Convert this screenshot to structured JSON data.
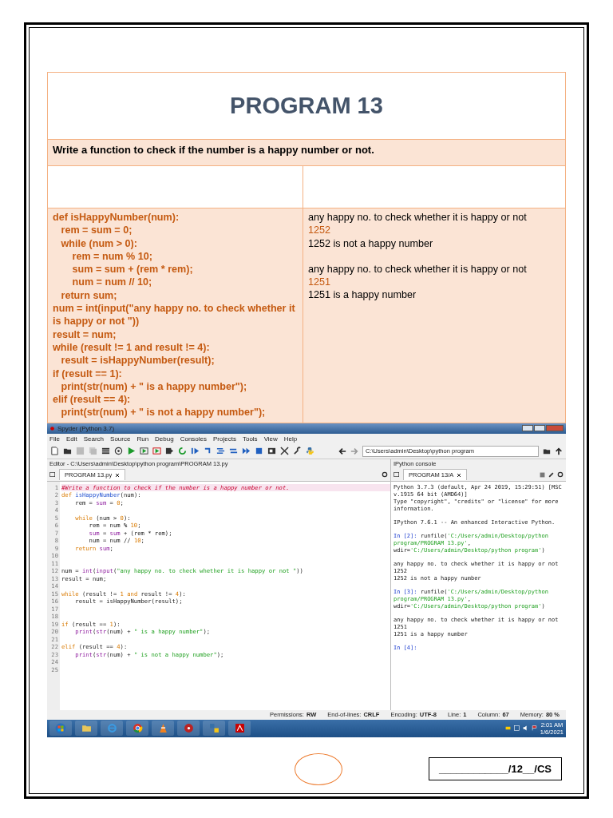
{
  "document": {
    "title": "PROGRAM 13",
    "task": "Write a function to check if the number is a happy number or not.",
    "program_lines": [
      "def isHappyNumber(num):",
      "   rem = sum = 0;",
      "   while (num > 0):",
      "       rem = num % 10;",
      "       sum = sum + (rem * rem);",
      "       num = num // 10;",
      "   return sum;",
      "num = int(input(\"any happy no. to check whether it is happy or not \"))",
      "result = num;",
      "while (result != 1 and result != 4):",
      "   result = isHappyNumber(result);",
      "if (result == 1):",
      "   print(str(num) + \" is a happy number\");",
      "elif (result == 4):",
      "   print(str(num) + \" is not a happy number\");"
    ],
    "output_runs": [
      {
        "prompt": "any happy no. to check whether it is happy or not",
        "input": "1252",
        "result": "1252 is not a happy number"
      },
      {
        "prompt": "any happy no. to check whether it is happy or not",
        "input": "1251",
        "result": "1251 is a happy number"
      }
    ]
  },
  "spyder": {
    "window_title": "Spyder (Python 3.7)",
    "menu": [
      "File",
      "Edit",
      "Search",
      "Source",
      "Run",
      "Debug",
      "Consoles",
      "Projects",
      "Tools",
      "View",
      "Help"
    ],
    "path_field": "C:\\Users\\admin\\Desktop\\python program",
    "editor_header": "Editor - C:\\Users\\admin\\Desktop\\python program\\PROGRAM 13.py",
    "editor_tab": "PROGRAM 13.py",
    "editor_lines": [
      {
        "n": "1",
        "parts": [
          {
            "kind": "comment",
            "text": "#Write a function to check if the number is a happy number or not."
          }
        ]
      },
      {
        "n": "2",
        "parts": [
          {
            "kind": "keyword",
            "text": "def "
          },
          {
            "kind": "defname",
            "text": "isHappyNumber"
          },
          {
            "kind": "plain",
            "text": "(num):"
          }
        ]
      },
      {
        "n": "3",
        "parts": [
          {
            "kind": "plain",
            "text": "    rem = "
          },
          {
            "kind": "builtin",
            "text": "sum"
          },
          {
            "kind": "plain",
            "text": " = "
          },
          {
            "kind": "number",
            "text": "0"
          },
          {
            "kind": "plain",
            "text": ";"
          }
        ]
      },
      {
        "n": "4"
      },
      {
        "n": "5",
        "parts": [
          {
            "kind": "keyword",
            "text": "    while"
          },
          {
            "kind": "plain",
            "text": " (num > "
          },
          {
            "kind": "number",
            "text": "0"
          },
          {
            "kind": "plain",
            "text": "):"
          }
        ]
      },
      {
        "n": "6",
        "parts": [
          {
            "kind": "plain",
            "text": "        rem = num % "
          },
          {
            "kind": "number",
            "text": "10"
          },
          {
            "kind": "plain",
            "text": ";"
          }
        ]
      },
      {
        "n": "7",
        "parts": [
          {
            "kind": "builtin",
            "text": "        sum"
          },
          {
            "kind": "plain",
            "text": " = "
          },
          {
            "kind": "builtin",
            "text": "sum"
          },
          {
            "kind": "plain",
            "text": " + (rem * rem);"
          }
        ]
      },
      {
        "n": "8",
        "parts": [
          {
            "kind": "plain",
            "text": "        num = num // "
          },
          {
            "kind": "number",
            "text": "10"
          },
          {
            "kind": "plain",
            "text": ";"
          }
        ]
      },
      {
        "n": "9",
        "parts": [
          {
            "kind": "keyword",
            "text": "    return "
          },
          {
            "kind": "builtin",
            "text": "sum"
          },
          {
            "kind": "plain",
            "text": ";"
          }
        ]
      },
      {
        "n": "10"
      },
      {
        "n": "11"
      },
      {
        "n": "12",
        "parts": [
          {
            "kind": "plain",
            "text": "num = "
          },
          {
            "kind": "builtin",
            "text": "int"
          },
          {
            "kind": "plain",
            "text": "("
          },
          {
            "kind": "builtin",
            "text": "input"
          },
          {
            "kind": "plain",
            "text": "("
          },
          {
            "kind": "string",
            "text": "\"any happy no. to check whether it is happy or not \""
          },
          {
            "kind": "plain",
            "text": "))"
          }
        ]
      },
      {
        "n": "13",
        "parts": [
          {
            "kind": "plain",
            "text": "result = num;"
          }
        ]
      },
      {
        "n": "14"
      },
      {
        "n": "15",
        "parts": [
          {
            "kind": "keyword",
            "text": "while"
          },
          {
            "kind": "plain",
            "text": " (result != "
          },
          {
            "kind": "number",
            "text": "1"
          },
          {
            "kind": "keyword",
            "text": " and"
          },
          {
            "kind": "plain",
            "text": " result != "
          },
          {
            "kind": "number",
            "text": "4"
          },
          {
            "kind": "plain",
            "text": "):"
          }
        ]
      },
      {
        "n": "16",
        "parts": [
          {
            "kind": "plain",
            "text": "    result = isHappyNumber(result);"
          }
        ]
      },
      {
        "n": "17"
      },
      {
        "n": "18"
      },
      {
        "n": "19",
        "parts": [
          {
            "kind": "keyword",
            "text": "if"
          },
          {
            "kind": "plain",
            "text": " (result == "
          },
          {
            "kind": "number",
            "text": "1"
          },
          {
            "kind": "plain",
            "text": "):"
          }
        ]
      },
      {
        "n": "20",
        "parts": [
          {
            "kind": "builtin",
            "text": "    print"
          },
          {
            "kind": "plain",
            "text": "("
          },
          {
            "kind": "builtin",
            "text": "str"
          },
          {
            "kind": "plain",
            "text": "(num) + "
          },
          {
            "kind": "string",
            "text": "\" is a happy number\""
          },
          {
            "kind": "plain",
            "text": ");"
          }
        ]
      },
      {
        "n": "21"
      },
      {
        "n": "22",
        "parts": [
          {
            "kind": "keyword",
            "text": "elif"
          },
          {
            "kind": "plain",
            "text": " (result == "
          },
          {
            "kind": "number",
            "text": "4"
          },
          {
            "kind": "plain",
            "text": "):"
          }
        ]
      },
      {
        "n": "23",
        "parts": [
          {
            "kind": "builtin",
            "text": "    print"
          },
          {
            "kind": "plain",
            "text": "("
          },
          {
            "kind": "builtin",
            "text": "str"
          },
          {
            "kind": "plain",
            "text": "(num) + "
          },
          {
            "kind": "string",
            "text": "\" is not a happy number\""
          },
          {
            "kind": "plain",
            "text": ");"
          }
        ]
      },
      {
        "n": "24"
      },
      {
        "n": "25"
      }
    ],
    "console_header": "IPython console",
    "console_tab": "PROGRAM 13/A",
    "console_blocks": [
      [
        [
          {
            "kind": "plain",
            "text": "Python 3.7.3 (default, Apr 24 2019, 15:29:51) [MSC v.1915 64 bit (AMD64)]"
          }
        ],
        [
          {
            "kind": "plain",
            "text": "Type \"copyright\", \"credits\" or \"license\" for more information."
          }
        ]
      ],
      [
        [
          {
            "kind": "plain",
            "text": "IPython 7.6.1 -- An enhanced Interactive Python."
          }
        ]
      ],
      [
        [
          {
            "kind": "prompt",
            "text": "In [2]: "
          },
          {
            "kind": "plain",
            "text": "runfile("
          },
          {
            "kind": "string",
            "text": "'C:/Users/admin/Desktop/python program/PROGRAM 13.py'"
          },
          {
            "kind": "plain",
            "text": ", wdir="
          },
          {
            "kind": "string",
            "text": "'C:/Users/admin/Desktop/python program'"
          },
          {
            "kind": "plain",
            "text": ")"
          }
        ]
      ],
      [
        [
          {
            "kind": "plain",
            "text": "any happy no. to check whether it is happy or not 1252"
          }
        ],
        [
          {
            "kind": "plain",
            "text": "1252 is not a happy number"
          }
        ]
      ],
      [
        [
          {
            "kind": "prompt",
            "text": "In [3]: "
          },
          {
            "kind": "plain",
            "text": "runfile("
          },
          {
            "kind": "string",
            "text": "'C:/Users/admin/Desktop/python program/PROGRAM 13.py'"
          },
          {
            "kind": "plain",
            "text": ", wdir="
          },
          {
            "kind": "string",
            "text": "'C:/Users/admin/Desktop/python program'"
          },
          {
            "kind": "plain",
            "text": ")"
          }
        ]
      ],
      [
        [
          {
            "kind": "plain",
            "text": "any happy no. to check whether it is happy or not 1251"
          }
        ],
        [
          {
            "kind": "plain",
            "text": "1251 is a happy number"
          }
        ]
      ],
      [
        [
          {
            "kind": "prompt",
            "text": "In [4]:"
          }
        ]
      ]
    ],
    "status": [
      {
        "label": "Permissions:",
        "value": "RW"
      },
      {
        "label": "End-of-lines:",
        "value": "CRLF"
      },
      {
        "label": "Encoding:",
        "value": "UTF-8"
      },
      {
        "label": "Line:",
        "value": "1"
      },
      {
        "label": "Column:",
        "value": "67"
      },
      {
        "label": "Memory:",
        "value": "80 %"
      }
    ],
    "clock": {
      "time": "2:01 AM",
      "date": "1/6/2021"
    }
  },
  "footer": {
    "code": "____________/12__/CS"
  }
}
